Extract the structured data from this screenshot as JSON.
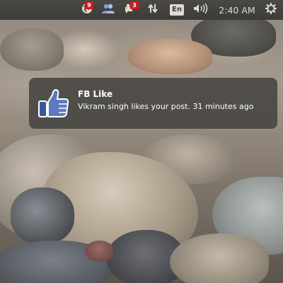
{
  "top_panel": {
    "messaging": {
      "icon": "messaging-globe-icon",
      "count": "9"
    },
    "social": {
      "icon": "people-icon"
    },
    "friends": {
      "icon": "friend-requests-icon",
      "count": "3"
    },
    "network": {
      "icon": "network-updown-arrows-icon"
    },
    "keyboard": {
      "layout": "En"
    },
    "sound": {
      "icon": "speaker-volume-icon"
    },
    "clock": {
      "time": "2:40 AM"
    },
    "session": {
      "icon": "gear-power-icon"
    }
  },
  "notification": {
    "icon": "facebook-thumbs-up-icon",
    "title": "FB Like",
    "body": "Vikram singh likes your post. 31 minutes ago"
  },
  "colors": {
    "panel": "#3c3b37",
    "badge": "#d11a1a",
    "facebook_blue": "#3b5998",
    "bubble": "#44423f"
  }
}
